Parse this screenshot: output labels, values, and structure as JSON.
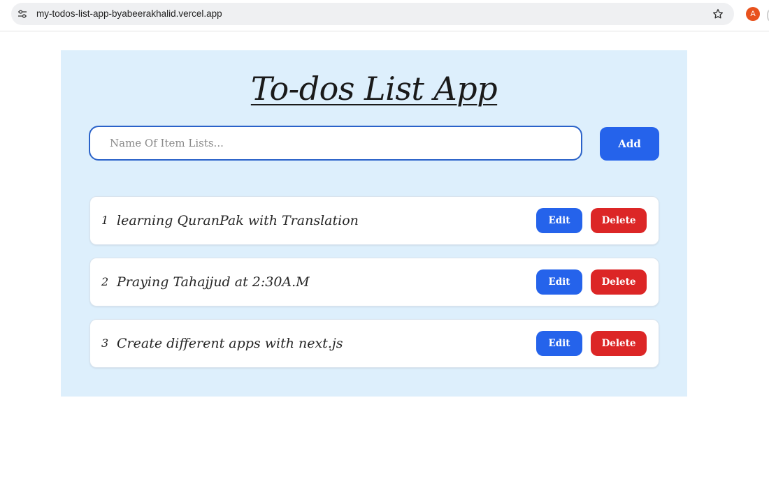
{
  "browser": {
    "url": "my-todos-list-app-byabeerakhalid.vercel.app",
    "profile_initial": "A",
    "profile_color": "#e8521d"
  },
  "app": {
    "title": "To-dos List App",
    "input": {
      "placeholder": "Name Of Item Lists...",
      "value": ""
    },
    "add_label": "Add",
    "accent_color": "#2563eb",
    "danger_color": "#dc2626",
    "panel_color": "#ddeffc",
    "todos": [
      {
        "number": "1",
        "text": "learning QuranPak with Translation",
        "edit_label": "Edit",
        "delete_label": "Delete"
      },
      {
        "number": "2",
        "text": "Praying Tahajjud at 2:30A.M",
        "edit_label": "Edit",
        "delete_label": "Delete"
      },
      {
        "number": "3",
        "text": "Create different apps with next.js",
        "edit_label": "Edit",
        "delete_label": "Delete"
      }
    ]
  }
}
